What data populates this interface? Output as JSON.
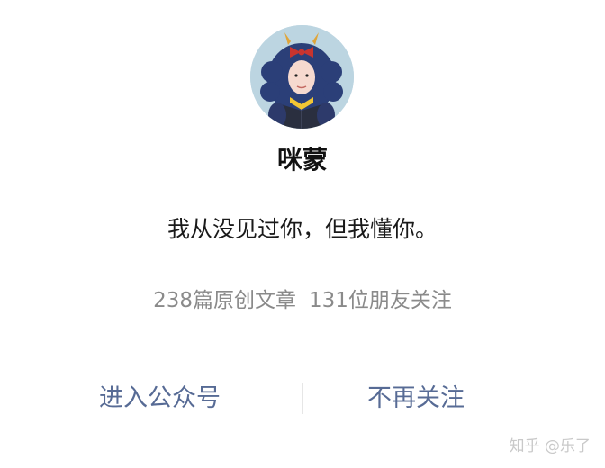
{
  "profile": {
    "name": "咪蒙",
    "bio": "我从没见过你，但我懂你。",
    "articles": "238篇原创文章",
    "friends_following": "131位朋友关注"
  },
  "actions": {
    "enter_label": "进入公众号",
    "unfollow_label": "不再关注"
  },
  "watermark": "知乎 @乐了",
  "colors": {
    "link": "#576b95",
    "secondary_text": "#8a8a8a",
    "primary_text": "#111111"
  },
  "icons": {
    "avatar": "illustrated-girl-avatar"
  }
}
